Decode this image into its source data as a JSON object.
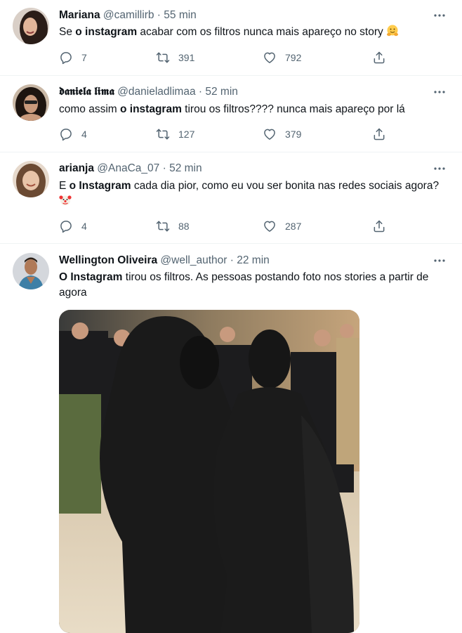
{
  "tweets": [
    {
      "name": "Mariana",
      "handle": "@camillirb",
      "sep": "·",
      "time": "55 min",
      "text": [
        {
          "t": "Se ",
          "b": false
        },
        {
          "t": "o instagram",
          "b": true
        },
        {
          "t": " acabar com os filtros nunca mais apareço no story ",
          "b": false
        }
      ],
      "emoji": "hugging-face",
      "replies": "7",
      "retweets": "391",
      "likes": "792"
    },
    {
      "name": "𝖉𝖆𝖓𝖎𝖊𝖑𝖆 𝖑𝖎𝖒𝖆",
      "handle": "@danieladlimaa",
      "sep": "·",
      "time": "52 min",
      "text": [
        {
          "t": "como assim ",
          "b": false
        },
        {
          "t": "o instagram",
          "b": true
        },
        {
          "t": " tirou os filtros???? nunca mais apareço por lá",
          "b": false
        }
      ],
      "replies": "4",
      "retweets": "127",
      "likes": "379"
    },
    {
      "name": "arianja",
      "handle": "@AnaCa_07",
      "sep": "·",
      "time": "52 min",
      "text": [
        {
          "t": "E ",
          "b": false
        },
        {
          "t": "o Instagram",
          "b": true
        },
        {
          "t": " cada dia pior, como eu vou ser bonita nas redes sociais agora? ",
          "b": false
        }
      ],
      "emoji": "clown-face",
      "replies": "4",
      "retweets": "88",
      "likes": "287"
    },
    {
      "name": "Wellington Oliveira",
      "handle": "@well_author",
      "sep": "·",
      "time": "22 min",
      "text": [
        {
          "t": "O Instagram",
          "b": true
        },
        {
          "t": " tirou os filtros. As pessoas postando foto nos stories a partir de agora",
          "b": false
        }
      ],
      "media": "photo-two-figures-in-black-full-face-outfits"
    }
  ],
  "icons": {
    "reply": "reply-icon",
    "retweet": "retweet-icon",
    "like": "like-icon",
    "share": "share-icon",
    "more": "more-icon"
  },
  "colors": {
    "text": "#0f1419",
    "muted": "#536471",
    "divider": "#eff3f4"
  }
}
